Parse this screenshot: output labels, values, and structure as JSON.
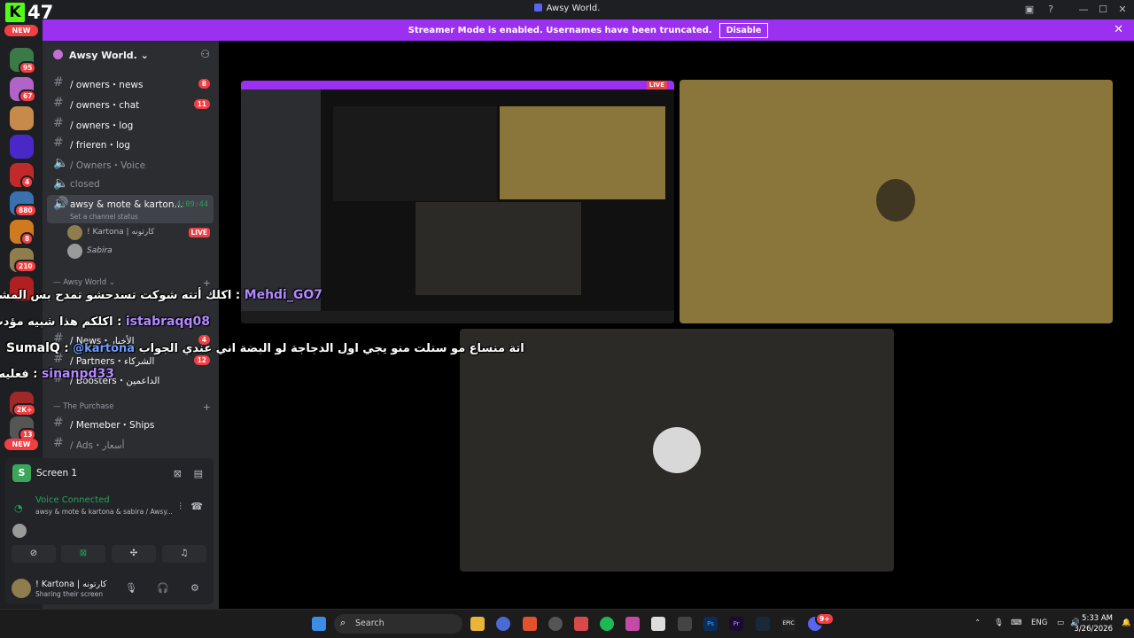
{
  "kick": {
    "logo": "K",
    "viewers": "47"
  },
  "window": {
    "title": "Awsy World."
  },
  "banner": {
    "text": "Streamer Mode is enabled. Usernames have been truncated.",
    "button": "Disable"
  },
  "guilds": {
    "new_top": "NEW",
    "new_bottom": "NEW",
    "badges": [
      "95",
      "67",
      "4",
      "880",
      "8",
      "210",
      "2K+",
      "13"
    ]
  },
  "server": {
    "name": "Awsy World."
  },
  "channels": [
    {
      "label": "/ owners・news",
      "count": "8"
    },
    {
      "label": "/ owners・chat",
      "count": "11"
    },
    {
      "label": "/ owners・log",
      "count": ""
    },
    {
      "label": "/ frieren・log",
      "count": ""
    },
    {
      "label": "/ Owners・Voice",
      "count": ""
    },
    {
      "label": "closed",
      "count": ""
    }
  ],
  "active_voice": {
    "name": "awsy & mote & karton...",
    "timer": "4:09:44",
    "status": "Set a channel status"
  },
  "voice_users": [
    {
      "name": "! Kartona | كارتونه",
      "live": "LIVE"
    },
    {
      "name": "Sabira",
      "live": ""
    }
  ],
  "categories": {
    "awsy_world": "— Awsy World",
    "purchase": "— The Purchase"
  },
  "lower_channels": [
    {
      "label": "/ News・الأخبار",
      "count": "4"
    },
    {
      "label": "/ Partners・الشركاء",
      "count": "12"
    },
    {
      "label": "/ Boosters・الداعمين",
      "count": ""
    },
    {
      "label": "/ Memeber・Ships",
      "count": ""
    },
    {
      "label": "/ Ads・أسعار",
      "count": ""
    }
  ],
  "stream_panel": {
    "screen_label": "Screen 1",
    "voice_connected": "Voice Connected",
    "voice_sub": "awsy & mote & kartona & sabira / Awsy...",
    "user_name": "! Kartona | كارتونه",
    "user_status": "Sharing their screen"
  },
  "chat_overlay": [
    {
      "user": "Mehdi_GO7",
      "sep": " : ",
      "message": "اكلك أتته شوكت تسدحشو تمدح بس المشرفين",
      "mention": ""
    },
    {
      "user": "istabraqq08",
      "sep": " : ",
      "message": "اكلكم هذا شبيه مؤدب",
      "mention": ""
    },
    {
      "user": "SumalQ",
      "sep": " : ",
      "message": "اتة منساع مو سنلت منو يجي اول الدجاجة لو البضة اني عندي الجواب",
      "mention": "@kartona"
    },
    {
      "user": "sinanpd33",
      "sep": " : ",
      "message": "فعليه",
      "mention": ""
    }
  ],
  "taskbar": {
    "search": "Search",
    "lang": "ENG",
    "time": "5:33 AM",
    "date": "3/26/2026",
    "discord_badge": "9+"
  },
  "colors": {
    "accent": "#9b30f0",
    "kick_green": "#53fc18",
    "online_green": "#23a55a",
    "badge_red": "#f23f43",
    "tile_gold": "#8a763a",
    "tile_grey": "#2b2a27"
  }
}
